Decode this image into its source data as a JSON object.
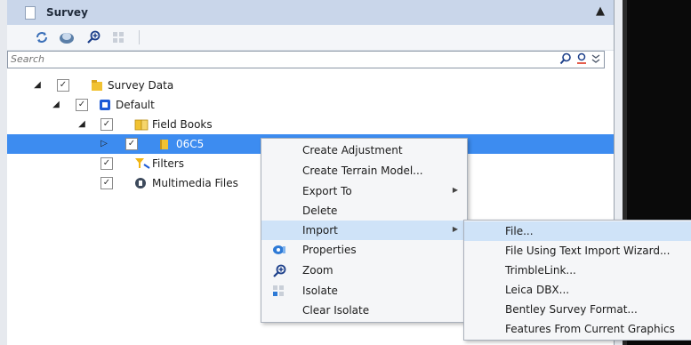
{
  "panel": {
    "title": "Survey"
  },
  "search": {
    "placeholder": "Search"
  },
  "tree": [
    {
      "label": "Survey Data",
      "icon": "folder-icon"
    },
    {
      "label": "Default",
      "icon": "default-icon"
    },
    {
      "label": "Field Books",
      "icon": "field-books-icon"
    },
    {
      "label": "06C5",
      "icon": "folder-icon"
    },
    {
      "label": "Filters",
      "icon": "filters-icon"
    },
    {
      "label": "Multimedia Files",
      "icon": "multimedia-icon"
    }
  ],
  "context_menu": {
    "items": [
      {
        "label": "Create Adjustment"
      },
      {
        "label": "Create Terrain Model..."
      },
      {
        "label": "Export To"
      },
      {
        "label": "Delete"
      },
      {
        "label": "Import"
      },
      {
        "label": "Properties"
      },
      {
        "label": "Zoom"
      },
      {
        "label": "Isolate"
      },
      {
        "label": "Clear Isolate"
      }
    ]
  },
  "import_submenu": {
    "items": [
      {
        "label": "File..."
      },
      {
        "label": "File Using Text Import Wizard..."
      },
      {
        "label": "TrimbleLink..."
      },
      {
        "label": "Leica DBX..."
      },
      {
        "label": "Bentley Survey Format..."
      },
      {
        "label": "Features From Current Graphics"
      }
    ]
  },
  "colors": {
    "selection": "#3d8cf0",
    "titlebar": "#c9d6ea",
    "menu_highlight": "#cfe3f8"
  }
}
